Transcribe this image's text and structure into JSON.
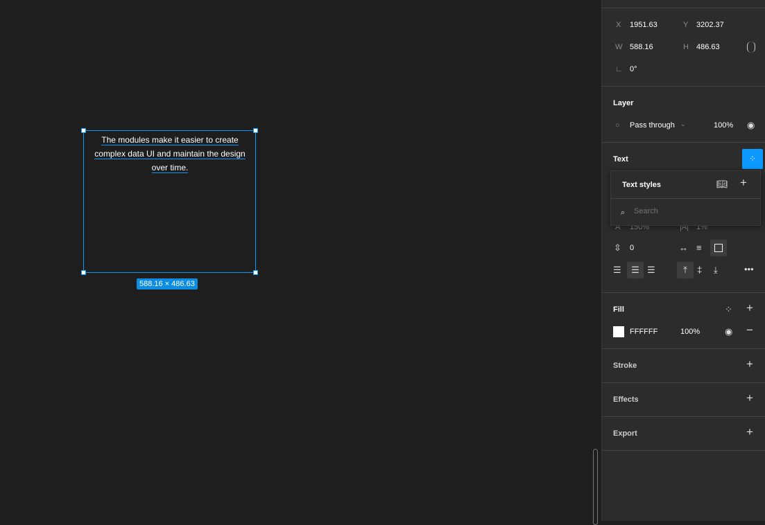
{
  "canvas": {
    "text_lines": [
      "The modules make it easier to create",
      "complex data UI and maintain the design",
      "over time."
    ],
    "size_badge": "588.16 × 486.63"
  },
  "panel": {
    "position": {
      "x_label": "X",
      "x": "1951.63",
      "y_label": "Y",
      "y": "3202.37",
      "w_label": "W",
      "w": "588.16",
      "h_label": "H",
      "h": "486.63",
      "rotation": "0°"
    },
    "layer": {
      "title": "Layer",
      "blend": "Pass through",
      "opacity": "100%"
    },
    "text": {
      "title": "Text",
      "line_height": "150%",
      "letter_spacing": "1%",
      "paragraph_spacing": "0"
    },
    "text_styles_popup": {
      "title": "Text styles",
      "search_placeholder": "Search"
    },
    "fill": {
      "title": "Fill",
      "hex": "FFFFFF",
      "opacity": "100%",
      "color": "#FFFFFF"
    },
    "stroke": {
      "title": "Stroke"
    },
    "effects": {
      "title": "Effects"
    },
    "export": {
      "title": "Export"
    }
  },
  "colors": {
    "accent": "#0D99FF",
    "canvas": "#1E1E1E",
    "panel": "#2C2C2C"
  }
}
